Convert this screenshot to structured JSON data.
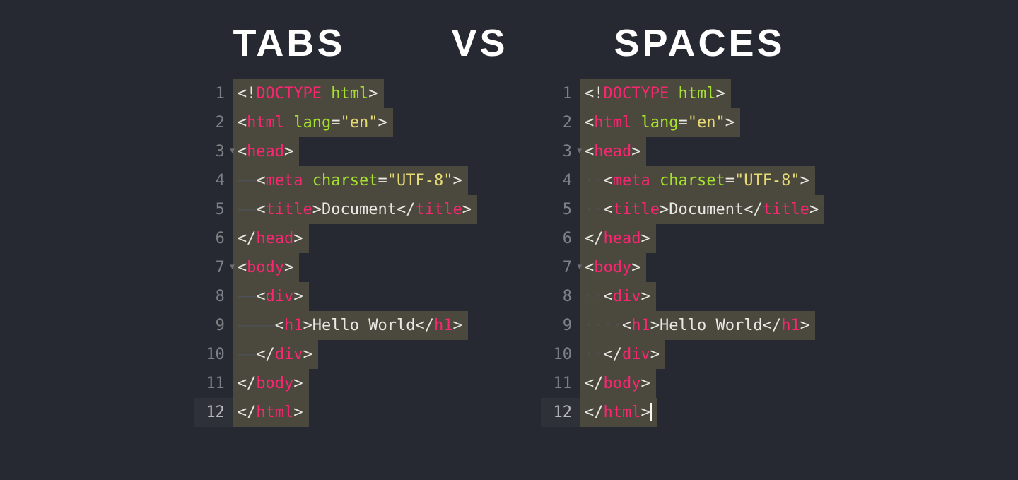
{
  "header": {
    "left": "TABS",
    "mid": "VS",
    "right": "SPACES"
  },
  "whitespace": {
    "tab": "——",
    "dot": "·"
  },
  "code": {
    "lines": [
      {
        "num": "1",
        "indent": 0,
        "fold": false,
        "tokens": [
          {
            "c": "pnc",
            "t": "<!"
          },
          {
            "c": "tag",
            "t": "DOCTYPE"
          },
          {
            "c": "txt",
            "t": " "
          },
          {
            "c": "attr",
            "t": "html"
          },
          {
            "c": "pnc",
            "t": ">"
          }
        ]
      },
      {
        "num": "2",
        "indent": 0,
        "fold": false,
        "tokens": [
          {
            "c": "pnc",
            "t": "<"
          },
          {
            "c": "tag",
            "t": "html"
          },
          {
            "c": "txt",
            "t": " "
          },
          {
            "c": "attr",
            "t": "lang"
          },
          {
            "c": "op",
            "t": "="
          },
          {
            "c": "str",
            "t": "\"en\""
          },
          {
            "c": "pnc",
            "t": ">"
          }
        ]
      },
      {
        "num": "3",
        "indent": 0,
        "fold": true,
        "tokens": [
          {
            "c": "pnc",
            "t": "<"
          },
          {
            "c": "tag",
            "t": "head"
          },
          {
            "c": "pnc",
            "t": ">"
          }
        ]
      },
      {
        "num": "4",
        "indent": 1,
        "fold": false,
        "tokens": [
          {
            "c": "pnc",
            "t": "<"
          },
          {
            "c": "tag",
            "t": "meta"
          },
          {
            "c": "txt",
            "t": " "
          },
          {
            "c": "attr",
            "t": "charset"
          },
          {
            "c": "op",
            "t": "="
          },
          {
            "c": "str",
            "t": "\"UTF-8\""
          },
          {
            "c": "pnc",
            "t": ">"
          }
        ]
      },
      {
        "num": "5",
        "indent": 1,
        "fold": false,
        "tokens": [
          {
            "c": "pnc",
            "t": "<"
          },
          {
            "c": "tag",
            "t": "title"
          },
          {
            "c": "pnc",
            "t": ">"
          },
          {
            "c": "txt",
            "t": "Document"
          },
          {
            "c": "pnc",
            "t": "</"
          },
          {
            "c": "tag",
            "t": "title"
          },
          {
            "c": "pnc",
            "t": ">"
          }
        ]
      },
      {
        "num": "6",
        "indent": 0,
        "fold": false,
        "tokens": [
          {
            "c": "pnc",
            "t": "</"
          },
          {
            "c": "tag",
            "t": "head"
          },
          {
            "c": "pnc",
            "t": ">"
          }
        ]
      },
      {
        "num": "7",
        "indent": 0,
        "fold": true,
        "tokens": [
          {
            "c": "pnc",
            "t": "<"
          },
          {
            "c": "tag",
            "t": "body"
          },
          {
            "c": "pnc",
            "t": ">"
          }
        ]
      },
      {
        "num": "8",
        "indent": 1,
        "fold": false,
        "tokens": [
          {
            "c": "pnc",
            "t": "<"
          },
          {
            "c": "tag",
            "t": "div"
          },
          {
            "c": "pnc",
            "t": ">"
          }
        ]
      },
      {
        "num": "9",
        "indent": 2,
        "fold": false,
        "tokens": [
          {
            "c": "pnc",
            "t": "<"
          },
          {
            "c": "tag",
            "t": "h1"
          },
          {
            "c": "pnc",
            "t": ">"
          },
          {
            "c": "txt",
            "t": "Hello World"
          },
          {
            "c": "pnc",
            "t": "</"
          },
          {
            "c": "tag",
            "t": "h1"
          },
          {
            "c": "pnc",
            "t": ">"
          }
        ]
      },
      {
        "num": "10",
        "indent": 1,
        "fold": false,
        "tokens": [
          {
            "c": "pnc",
            "t": "</"
          },
          {
            "c": "tag",
            "t": "div"
          },
          {
            "c": "pnc",
            "t": ">"
          }
        ]
      },
      {
        "num": "11",
        "indent": 0,
        "fold": false,
        "tokens": [
          {
            "c": "pnc",
            "t": "</"
          },
          {
            "c": "tag",
            "t": "body"
          },
          {
            "c": "pnc",
            "t": ">"
          }
        ]
      },
      {
        "num": "12",
        "indent": 0,
        "fold": false,
        "tokens": [
          {
            "c": "pnc",
            "t": "</"
          },
          {
            "c": "tag",
            "t": "html"
          },
          {
            "c": "pnc",
            "t": ">"
          }
        ]
      }
    ]
  },
  "left_panel": {
    "mode": "tabs",
    "cursor_line": null,
    "current_line": "12"
  },
  "right_panel": {
    "mode": "spaces",
    "cursor_line": "12",
    "current_line": "12"
  }
}
